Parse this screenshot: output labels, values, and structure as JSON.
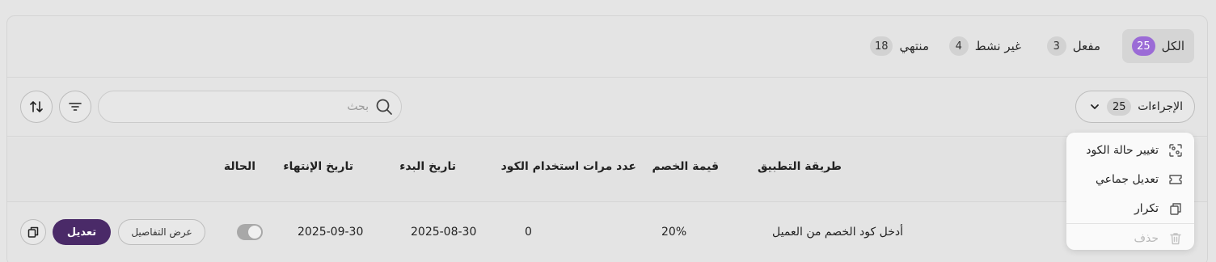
{
  "tabs": [
    {
      "label": "الكل",
      "count": "25"
    },
    {
      "label": "مفعل",
      "count": "3"
    },
    {
      "label": "غير نشط",
      "count": "4"
    },
    {
      "label": "منتهي",
      "count": "18"
    }
  ],
  "toolbar": {
    "actions_label": "الإجراءات",
    "actions_count": "25",
    "search_placeholder": "بحث"
  },
  "table": {
    "headers": {
      "method": "طريقة التطبيق",
      "discount": "قيمة الخصم",
      "usage": "عدد مرات استخدام الكود",
      "start": "تاريخ البدء",
      "end": "تاريخ الإنتهاء",
      "status": "الحالة"
    },
    "rows": [
      {
        "method": "أدخل كود الخصم من العميل",
        "discount": "20%",
        "usage": "0",
        "start": "2025-08-30",
        "end": "2025-09-30",
        "status_on": false,
        "details_label": "عرض التفاصيل",
        "edit_label": "تعديل"
      }
    ]
  },
  "menu": {
    "items": [
      {
        "label": "تغيير حالة الكود",
        "icon": "status-change-icon"
      },
      {
        "label": "تعديل جماعي",
        "icon": "bulk-edit-icon"
      },
      {
        "label": "تكرار",
        "icon": "duplicate-icon"
      },
      {
        "label": "حذف",
        "icon": "trash-icon",
        "disabled": true
      }
    ]
  },
  "colors": {
    "accent": "#9b6bd6",
    "primary": "#4a2a68"
  }
}
